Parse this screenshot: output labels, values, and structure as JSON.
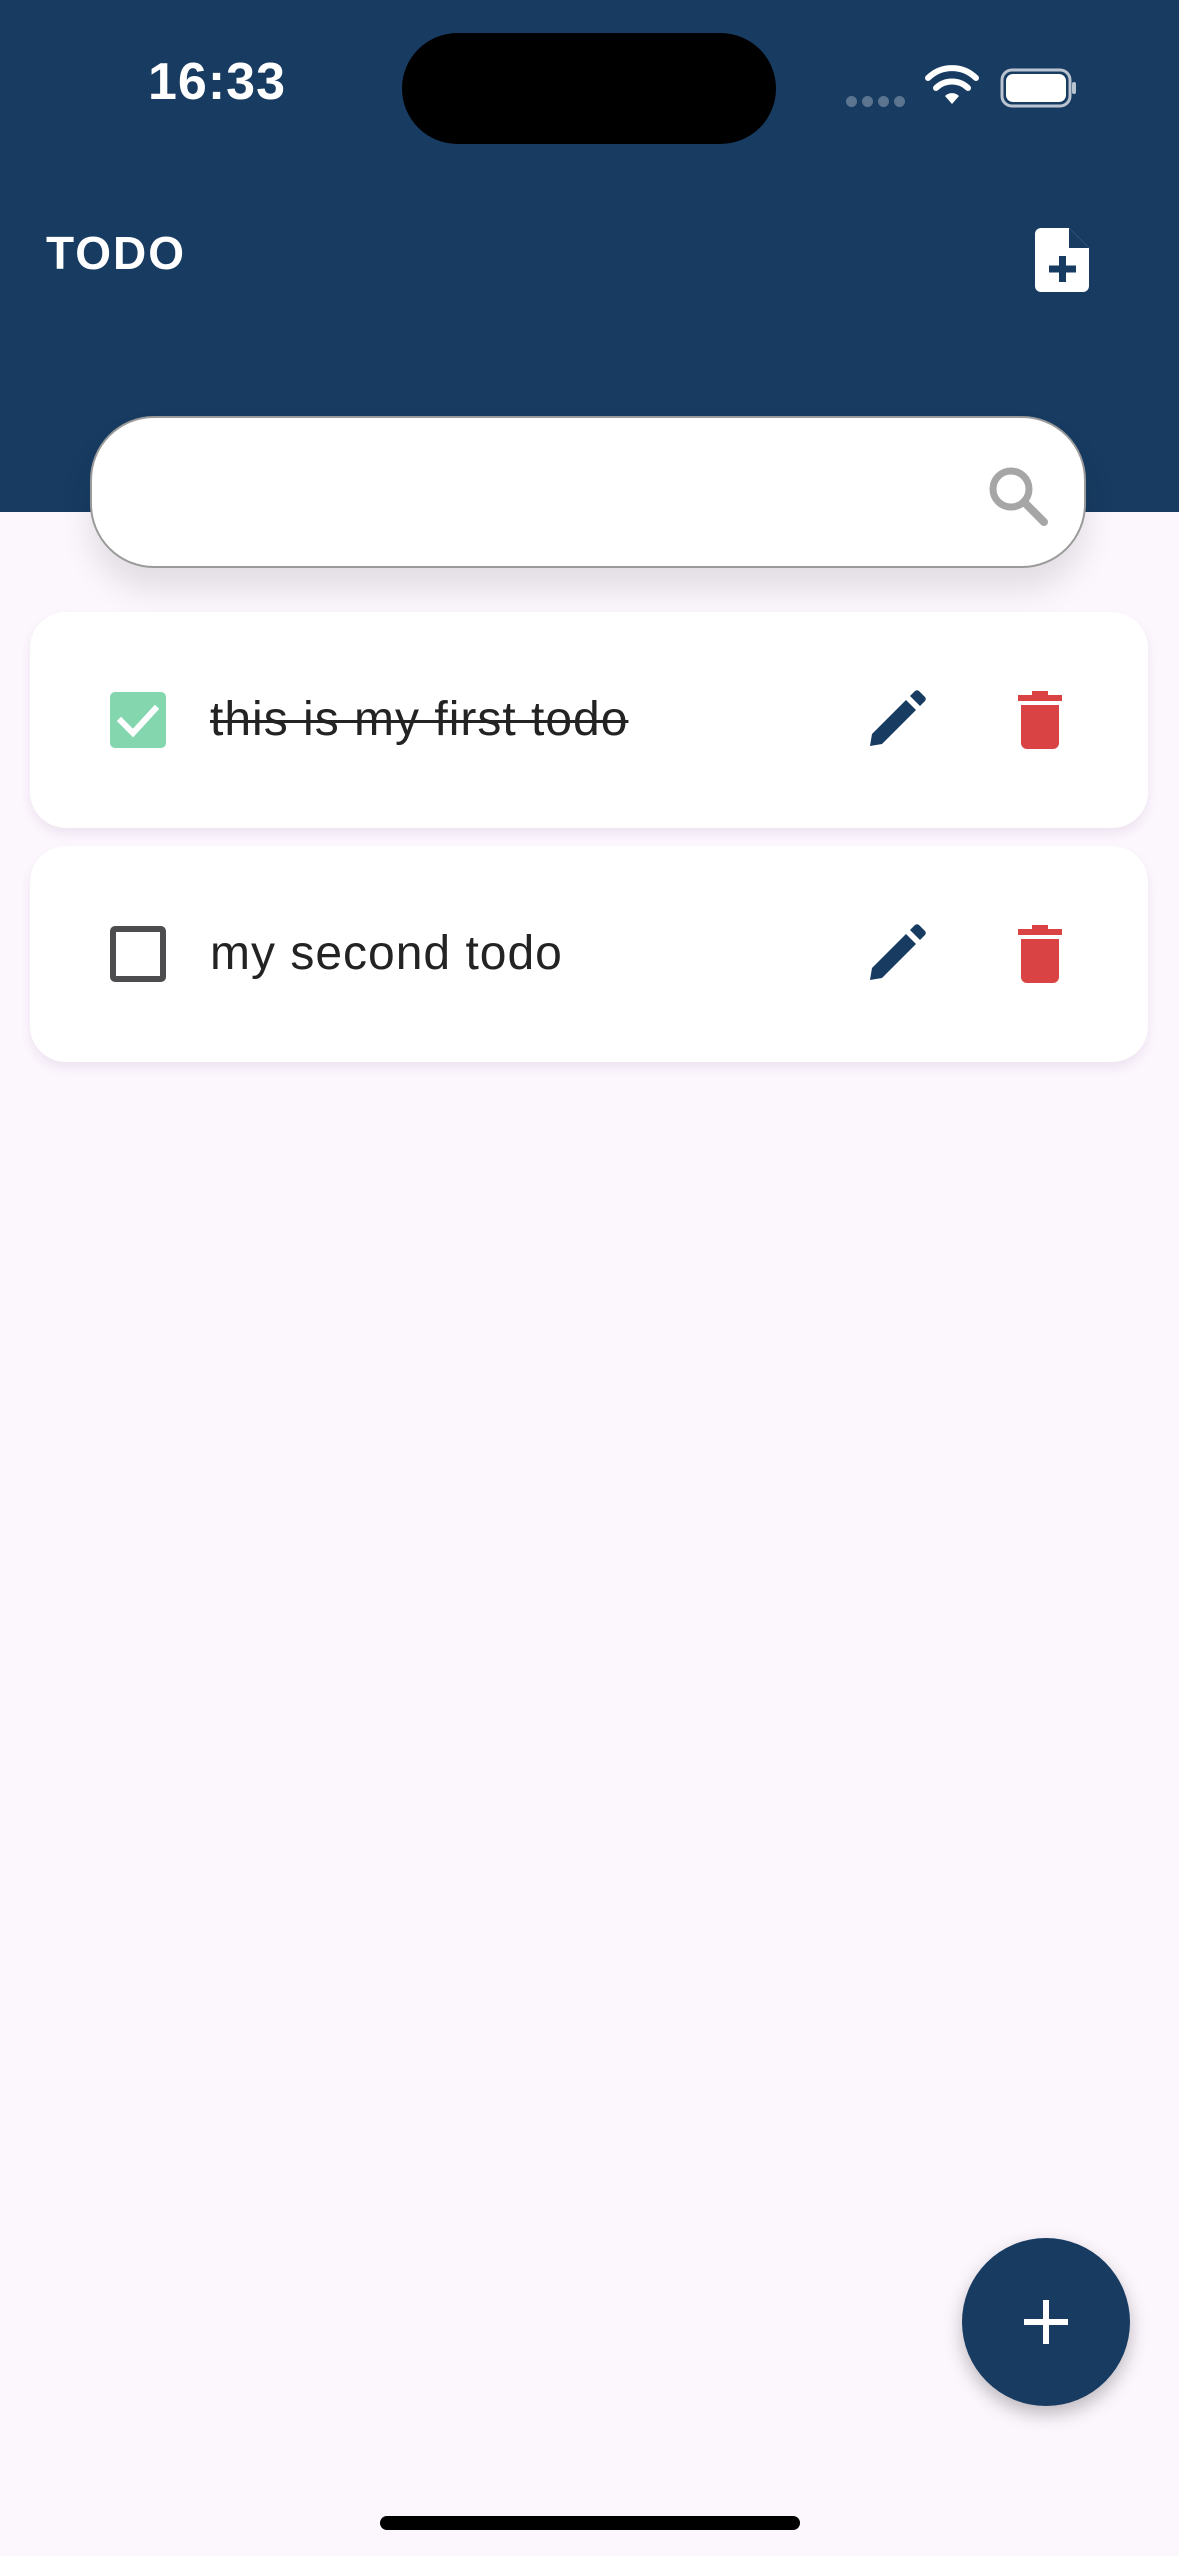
{
  "status_bar": {
    "time": "16:33"
  },
  "header": {
    "title": "TODO",
    "action_icon": "file-plus-icon"
  },
  "search": {
    "value": "",
    "placeholder": "",
    "icon": "search-icon"
  },
  "todos": [
    {
      "text": "this is my first todo",
      "completed": true
    },
    {
      "text": "my second todo",
      "completed": false
    }
  ],
  "fab": {
    "icon": "plus-icon"
  },
  "colors": {
    "primary": "#173b61",
    "background": "#fcf6fd",
    "check": "#83d6ad",
    "delete": "#d94343"
  }
}
